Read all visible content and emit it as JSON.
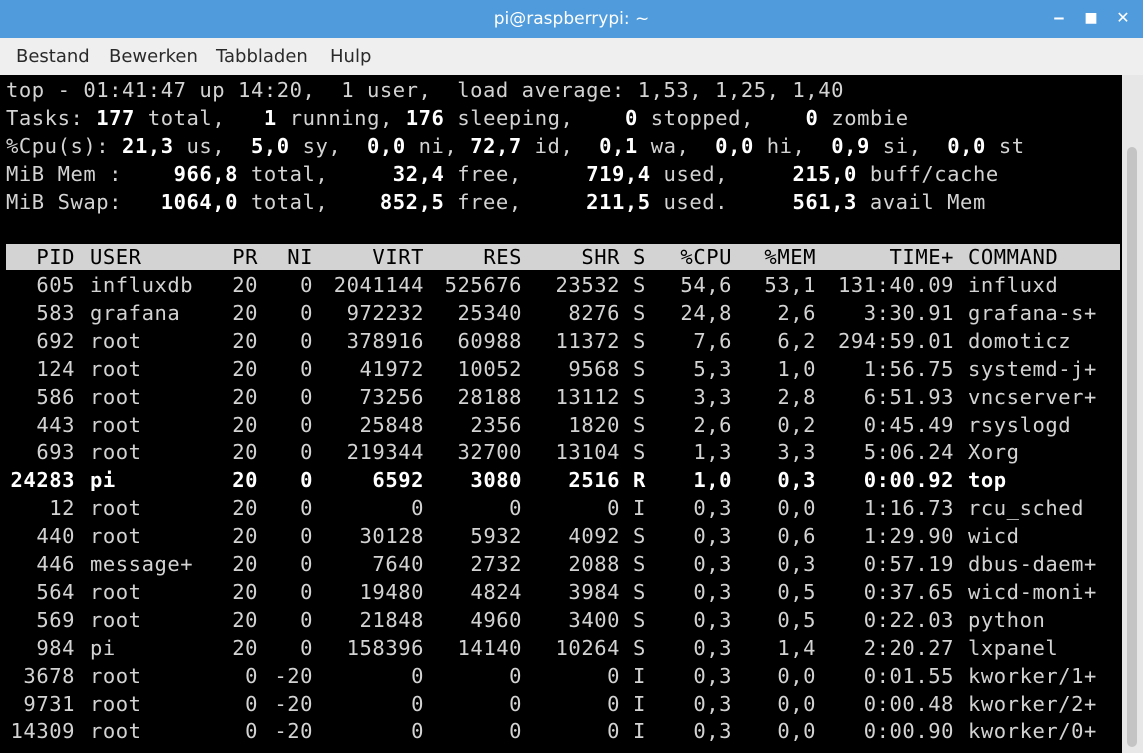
{
  "window": {
    "title": "pi@raspberrypi: ~"
  },
  "menu": [
    "Bestand",
    "Bewerken",
    "Tabbladen",
    "Hulp"
  ],
  "summary": {
    "line1": "top - 01:41:47 up 14:20,  1 user,  load average: 1,53, 1,25, 1,40",
    "tasks": {
      "label": "Tasks:",
      "total": "177",
      "total_label": "total,",
      "running": "1",
      "running_label": "running,",
      "sleeping": "176",
      "sleeping_label": "sleeping,",
      "stopped": "0",
      "stopped_label": "stopped,",
      "zombie": "0",
      "zombie_label": "zombie"
    },
    "cpu": {
      "label": "%Cpu(s):",
      "us": "21,3",
      "sy": "5,0",
      "ni": "0,0",
      "id": "72,7",
      "wa": "0,1",
      "hi": "0,0",
      "si": "0,9",
      "st": "0,0"
    },
    "mem": {
      "label": "MiB Mem :",
      "total": "966,8",
      "free": "32,4",
      "used": "719,4",
      "buff_cache": "215,0"
    },
    "swap": {
      "label": "MiB Swap:",
      "total": "1064,0",
      "free": "852,5",
      "used": "211,5",
      "avail_mem": "561,3"
    }
  },
  "columns": [
    "PID",
    "USER",
    "PR",
    "NI",
    "VIRT",
    "RES",
    "SHR",
    "S",
    "%CPU",
    "%MEM",
    "TIME+",
    "COMMAND"
  ],
  "processes": [
    [
      "605",
      "influxdb",
      "20",
      "0",
      "2041144",
      "525676",
      "23532",
      "S",
      "54,6",
      "53,1",
      "131:40.09",
      "influxd"
    ],
    [
      "583",
      "grafana",
      "20",
      "0",
      "972232",
      "25340",
      "8276",
      "S",
      "24,8",
      "2,6",
      "3:30.91",
      "grafana-s+"
    ],
    [
      "692",
      "root",
      "20",
      "0",
      "378916",
      "60988",
      "11372",
      "S",
      "7,6",
      "6,2",
      "294:59.01",
      "domoticz"
    ],
    [
      "124",
      "root",
      "20",
      "0",
      "41972",
      "10052",
      "9568",
      "S",
      "5,3",
      "1,0",
      "1:56.75",
      "systemd-j+"
    ],
    [
      "586",
      "root",
      "20",
      "0",
      "73256",
      "28188",
      "13112",
      "S",
      "3,3",
      "2,8",
      "6:51.93",
      "vncserver+"
    ],
    [
      "443",
      "root",
      "20",
      "0",
      "25848",
      "2356",
      "1820",
      "S",
      "2,6",
      "0,2",
      "0:45.49",
      "rsyslogd"
    ],
    [
      "693",
      "root",
      "20",
      "0",
      "219344",
      "32700",
      "13104",
      "S",
      "1,3",
      "3,3",
      "5:06.24",
      "Xorg"
    ],
    [
      "24283",
      "pi",
      "20",
      "0",
      "6592",
      "3080",
      "2516",
      "R",
      "1,0",
      "0,3",
      "0:00.92",
      "top"
    ],
    [
      "12",
      "root",
      "20",
      "0",
      "0",
      "0",
      "0",
      "I",
      "0,3",
      "0,0",
      "1:16.73",
      "rcu_sched"
    ],
    [
      "440",
      "root",
      "20",
      "0",
      "30128",
      "5932",
      "4092",
      "S",
      "0,3",
      "0,6",
      "1:29.90",
      "wicd"
    ],
    [
      "446",
      "message+",
      "20",
      "0",
      "7640",
      "2732",
      "2088",
      "S",
      "0,3",
      "0,3",
      "0:57.19",
      "dbus-daem+"
    ],
    [
      "564",
      "root",
      "20",
      "0",
      "19480",
      "4824",
      "3984",
      "S",
      "0,3",
      "0,5",
      "0:37.65",
      "wicd-moni+"
    ],
    [
      "569",
      "root",
      "20",
      "0",
      "21848",
      "4960",
      "3400",
      "S",
      "0,3",
      "0,5",
      "0:22.03",
      "python"
    ],
    [
      "984",
      "pi",
      "20",
      "0",
      "158396",
      "14140",
      "10264",
      "S",
      "0,3",
      "1,4",
      "2:20.27",
      "lxpanel"
    ],
    [
      "3678",
      "root",
      "0",
      "-20",
      "0",
      "0",
      "0",
      "I",
      "0,3",
      "0,0",
      "0:01.55",
      "kworker/1+"
    ],
    [
      "9731",
      "root",
      "0",
      "-20",
      "0",
      "0",
      "0",
      "I",
      "0,3",
      "0,0",
      "0:00.48",
      "kworker/2+"
    ],
    [
      "14309",
      "root",
      "0",
      "-20",
      "0",
      "0",
      "0",
      "I",
      "0,3",
      "0,0",
      "0:00.90",
      "kworker/0+"
    ]
  ],
  "highlight_pid": "24283",
  "colors": {
    "titlebar": "#4f9bdc",
    "terminal_bg": "#000000",
    "terminal_fg": "#d3d3d3",
    "header_bg": "#d3d3d3"
  }
}
